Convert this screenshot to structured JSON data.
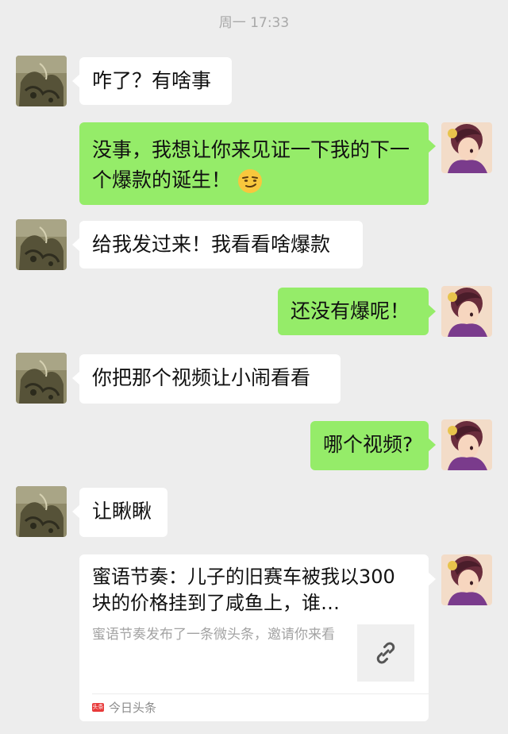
{
  "timestamp": "周一 17:33",
  "messages": [
    {
      "text": "咋了？有啥事"
    },
    {
      "text": "没事，我想让你来见证一下我的下一个爆款的诞生！"
    },
    {
      "text": "给我发过来！我看看啥爆款"
    },
    {
      "text": "还没有爆呢！"
    },
    {
      "text": "你把那个视频让小闹看看"
    },
    {
      "text": "哪个视频?"
    },
    {
      "text": "让瞅瞅"
    }
  ],
  "share_card": {
    "title": "蜜语节奏：儿子的旧赛车被我以300块的价格挂到了咸鱼上，谁…",
    "description": "蜜语节奏发布了一条微头条，邀请你来看",
    "source_logo": "头条",
    "source_name": "今日头条"
  },
  "colors": {
    "background": "#ededed",
    "incoming_bubble": "#ffffff",
    "outgoing_bubble": "#95ec69",
    "timestamp": "#a8a8a8"
  }
}
